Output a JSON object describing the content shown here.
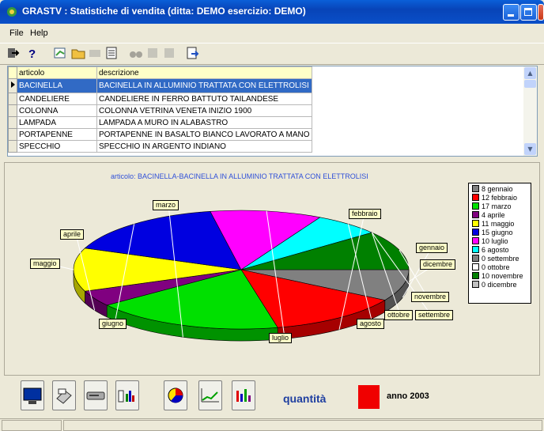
{
  "window": {
    "title": "GRASTV : Statistiche di vendita    (ditta: DEMO  esercizio: DEMO)"
  },
  "menu": [
    {
      "label": "File"
    },
    {
      "label": "Help"
    }
  ],
  "toolbar_icons": [
    "exit-icon",
    "help-icon",
    "open-icon",
    "folder-icon",
    "disabled-icon",
    "document-icon",
    "binoculars-icon",
    "disabled-icon",
    "disabled-icon",
    "export-icon"
  ],
  "grid": {
    "columns": [
      "articolo",
      "descrizione"
    ],
    "rows": [
      {
        "articolo": "BACINELLA",
        "descrizione": "BACINELLA IN ALLUMINIO TRATTATA CON ELETTROLISI"
      },
      {
        "articolo": "CANDELIERE",
        "descrizione": "CANDELIERE IN FERRO BATTUTO TAILANDESE"
      },
      {
        "articolo": "COLONNA",
        "descrizione": "COLONNA VETRINA VENETA INIZIO 1900"
      },
      {
        "articolo": "LAMPADA",
        "descrizione": "LAMPADA A MURO IN ALABASTRO"
      },
      {
        "articolo": "PORTAPENNE",
        "descrizione": "PORTAPENNE IN BASALTO BIANCO LAVORATO A MANO"
      },
      {
        "articolo": "SPECCHIO",
        "descrizione": "SPECCHIO IN ARGENTO INDIANO"
      }
    ]
  },
  "chart_data": {
    "type": "pie",
    "title": "articolo: BACINELLA-BACINELLA IN ALLUMINIO TRATTATA CON ELETTROLISI",
    "categories": [
      "gennaio",
      "febbraio",
      "marzo",
      "aprile",
      "maggio",
      "giugno",
      "luglio",
      "agosto",
      "settembre",
      "ottobre",
      "novembre",
      "dicembre"
    ],
    "values": [
      8,
      12,
      17,
      4,
      11,
      15,
      10,
      6,
      0,
      0,
      10,
      0
    ],
    "legend": [
      "8 gennaio",
      "12 febbraio",
      "17 marzo",
      "4 aprile",
      "11 maggio",
      "15 giugno",
      "10 luglio",
      "6 agosto",
      "0 settembre",
      "0 ottobre",
      "10 novembre",
      "0 dicembre"
    ],
    "colors": [
      "#808080",
      "#ff0000",
      "#00e000",
      "#800080",
      "#ffff00",
      "#0000e0",
      "#ff00ff",
      "#00ffff",
      "#808080",
      "#ffffff",
      "#008000",
      "#c0c0c0"
    ],
    "legend_position": "right"
  },
  "bottom_buttons": [
    "monitor-icon",
    "printer-icon",
    "drive-icon",
    "bar-chart-icon",
    "pie-chart-icon",
    "line-chart-icon",
    "column-chart-icon"
  ],
  "footer": {
    "measure": "quantità",
    "year_label": "anno 2003",
    "year_color": "#f00000"
  }
}
